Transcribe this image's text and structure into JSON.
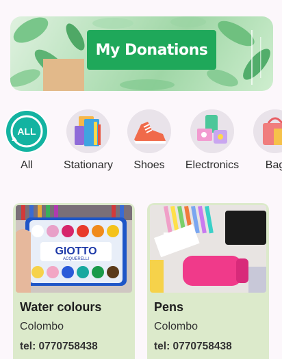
{
  "banner": {
    "title": "My Donations"
  },
  "categories": [
    {
      "label": "All",
      "icon": "all-icon",
      "badge": "ALL"
    },
    {
      "label": "Stationary",
      "icon": "stationary-icon"
    },
    {
      "label": "Shoes",
      "icon": "shoe-icon"
    },
    {
      "label": "Electronics",
      "icon": "electronics-icon"
    },
    {
      "label": "Bag",
      "icon": "bag-icon"
    }
  ],
  "items": [
    {
      "title": "Water colours",
      "location": "Colombo",
      "phone": "tel: 0770758438",
      "image_brand": "GIOTTO",
      "image_sub": "ACQUERELLI"
    },
    {
      "title": "Pens",
      "location": "Colombo",
      "phone": "tel: 0770758438"
    }
  ],
  "colors": {
    "accent": "#1fa85a",
    "card_bg": "#dceacb",
    "page_bg": "#fcf7fb",
    "all_icon": "#13b3a1"
  }
}
